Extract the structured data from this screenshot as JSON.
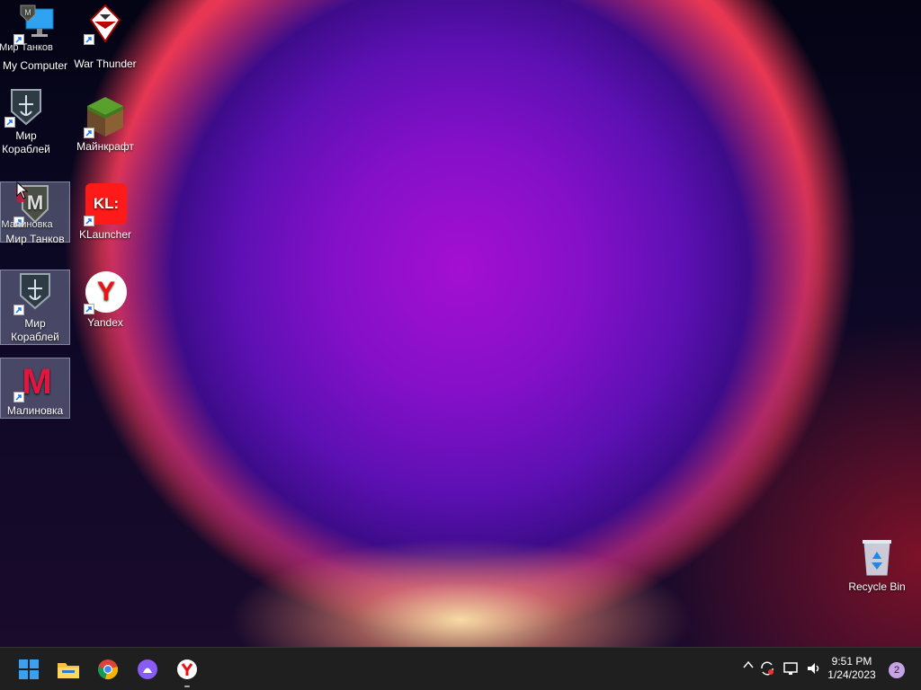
{
  "desktop": {
    "icons": [
      {
        "label": "My Computer",
        "overlay_text": "Мир Танков"
      },
      {
        "label": "War Thunder"
      },
      {
        "label": "Мир Кораблей"
      },
      {
        "label": "Майнкрафт"
      },
      {
        "label": "Мир Танков",
        "overlay_text": "Малиновка"
      },
      {
        "label": "KLauncher",
        "logo_text": "KL:"
      },
      {
        "label": "Мир Кораблей"
      },
      {
        "label": "Yandex",
        "logo_text": "Y"
      },
      {
        "label": "Малиновка",
        "logo_text": "M"
      },
      {
        "label": "Recycle Bin"
      }
    ]
  },
  "taskbar": {
    "apps": [
      "windows-start-icon",
      "file-explorer-icon",
      "chrome-icon",
      "alice-icon",
      "yandex-browser-icon"
    ],
    "tray_icons": [
      "chevron-up-icon",
      "sync-icon",
      "network-icon",
      "volume-icon"
    ],
    "clock": {
      "time": "9:51 PM",
      "date": "1/24/2023"
    },
    "notification_count": "2"
  },
  "colors": {
    "accent": "#0a84ff",
    "taskbar": "#1f1f1f",
    "selection": "#b4bedc"
  }
}
